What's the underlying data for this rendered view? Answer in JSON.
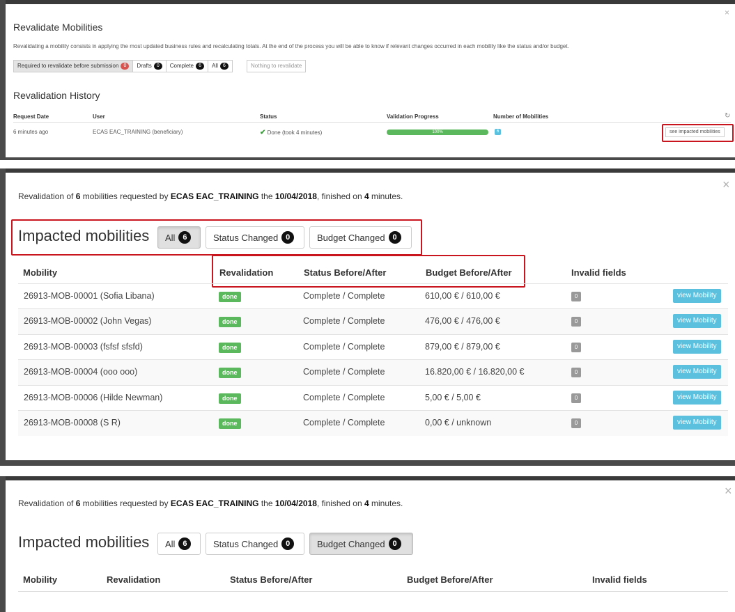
{
  "colors": {
    "accent": "#5bc0de",
    "success": "#5cb85c",
    "highlight": "#c9151e",
    "badge_dark": "#111111",
    "badge_red": "#d9534f"
  },
  "panel1": {
    "title": "Revalidate Mobilities",
    "description": "Revalidating a mobility consists in applying the most updated business rules and recalculating totals. At the end of the process you will be able to know if relevant changes occurred in each mobility like the status and/or budget.",
    "filters": [
      {
        "label": "Required to revalidate before submission",
        "count": "0"
      },
      {
        "label": "Drafts",
        "count": "0"
      },
      {
        "label": "Complete",
        "count": "6"
      },
      {
        "label": "All",
        "count": "6"
      }
    ],
    "nothing_label": "Nothing to revalidate",
    "history_title": "Revalidation History",
    "headers": {
      "request_date": "Request Date",
      "user": "User",
      "status": "Status",
      "progress": "Validation Progress",
      "count": "Number of Mobilities"
    },
    "row": {
      "date": "6 minutes ago",
      "user": "ECAS EAC_TRAINING (beneficiary)",
      "status": "Done (took 4 minutes)",
      "progress": "100%",
      "progress_value": 1.0,
      "count": "6",
      "button": "see impacted mobilities"
    },
    "refresh_icon": "refresh-icon"
  },
  "modal": {
    "intro": {
      "p1": "Revalidation of ",
      "count": "6",
      "p2": " mobilities requested by ",
      "user": "ECAS EAC_TRAINING",
      "p3": " the ",
      "date": "10/04/2018",
      "p4": ", finished on ",
      "minutes": "4",
      "p5": " minutes."
    },
    "title": "Impacted mobilities",
    "buttons": {
      "all": "All",
      "all_count": "6",
      "status": "Status Changed",
      "status_count": "0",
      "budget": "Budget Changed",
      "budget_count": "0"
    },
    "headers": {
      "mobility": "Mobility",
      "revalidation": "Revalidation",
      "status": "Status Before/After",
      "budget": "Budget Before/After",
      "invalid": "Invalid fields"
    },
    "rows": [
      {
        "mobility": "26913-MOB-00001 (Sofia Libana)",
        "revalidation": "done",
        "status": "Complete / Complete",
        "budget": "610,00 € / 610,00 €",
        "invalid": "0",
        "action": "view Mobility"
      },
      {
        "mobility": "26913-MOB-00002 (John Vegas)",
        "revalidation": "done",
        "status": "Complete / Complete",
        "budget": "476,00 € / 476,00 €",
        "invalid": "0",
        "action": "view Mobility"
      },
      {
        "mobility": "26913-MOB-00003 (fsfsf sfsfd)",
        "revalidation": "done",
        "status": "Complete / Complete",
        "budget": "879,00 € / 879,00 €",
        "invalid": "0",
        "action": "view Mobility"
      },
      {
        "mobility": "26913-MOB-00004 (ooo ooo)",
        "revalidation": "done",
        "status": "Complete / Complete",
        "budget": "16.820,00 € / 16.820,00 €",
        "invalid": "0",
        "action": "view Mobility"
      },
      {
        "mobility": "26913-MOB-00006 (Hilde Newman)",
        "revalidation": "done",
        "status": "Complete / Complete",
        "budget": "5,00 € / 5,00 €",
        "invalid": "0",
        "action": "view Mobility"
      },
      {
        "mobility": "26913-MOB-00008 (S R)",
        "revalidation": "done",
        "status": "Complete / Complete",
        "budget": "0,00 € / unknown",
        "invalid": "0",
        "action": "view Mobility"
      }
    ]
  },
  "close_symbol": "×"
}
